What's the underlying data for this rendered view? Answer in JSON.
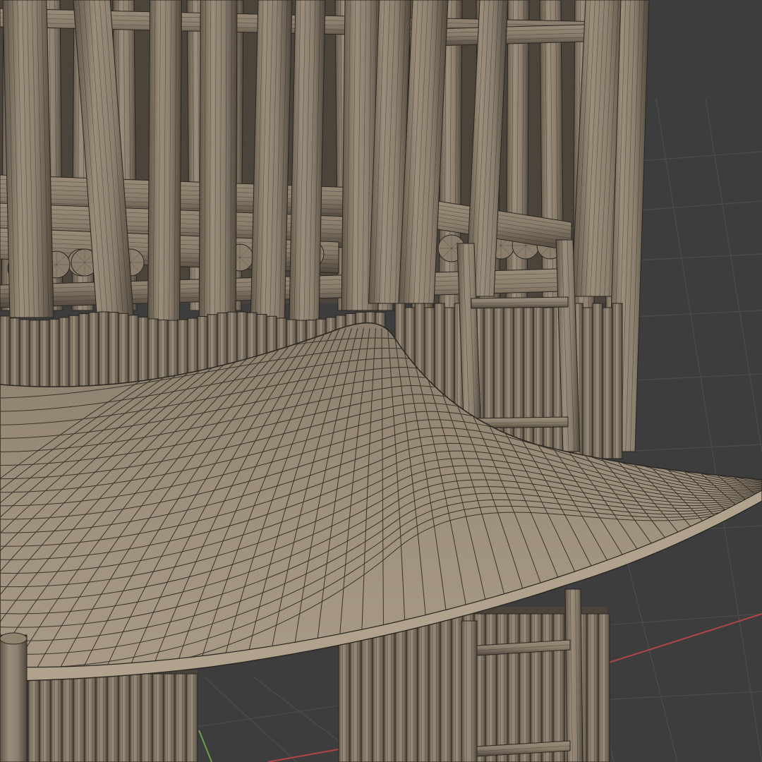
{
  "viewport": {
    "mode": "3d-wireframe-overlay",
    "background_color": "#3d3d3d",
    "grid_color": "#4a4a4a",
    "x_axis_color": "#b04545",
    "y_axis_color": "#6aa04a"
  },
  "model": {
    "subject": "wooden-stockade-tower-with-thatched-roof-and-ladder",
    "material_color": "#8c7f6e",
    "shadow_color": "#5e5447",
    "highlight_color": "#a89a86",
    "edge_color": "#2a2621"
  }
}
